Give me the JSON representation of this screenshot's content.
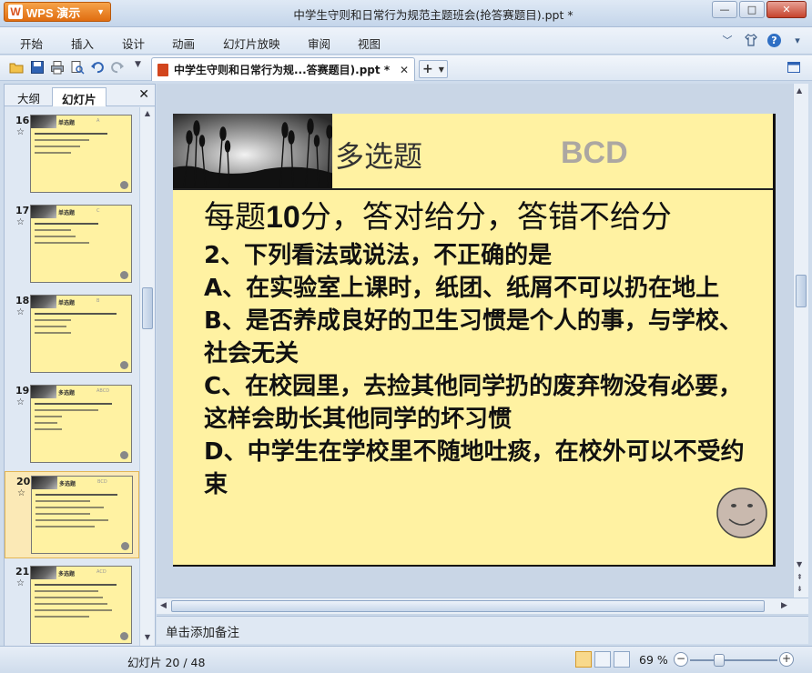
{
  "window": {
    "app_name": "WPS 演示",
    "title": "中学生守则和日常行为规范主题班会(抢答赛题目).ppt *",
    "min": "—",
    "max": "□",
    "close": "✕"
  },
  "menu": {
    "items": [
      "开始",
      "插入",
      "设计",
      "动画",
      "幻灯片放映",
      "审阅",
      "视图"
    ]
  },
  "tabstrip": {
    "doc_tab": "中学生守则和日常行为规...答赛题目).ppt *",
    "close": "✕",
    "add": "+"
  },
  "leftpanel": {
    "tabs": [
      "大纲",
      "幻灯片"
    ],
    "close": "✕",
    "thumbnails": [
      {
        "num": "16",
        "title": "单选题",
        "answer": "A",
        "star": "☆"
      },
      {
        "num": "17",
        "title": "单选题",
        "answer": "C",
        "star": "☆"
      },
      {
        "num": "18",
        "title": "单选题",
        "answer": "B",
        "star": "☆"
      },
      {
        "num": "19",
        "title": "多选题",
        "answer": "ABCD",
        "star": "☆"
      },
      {
        "num": "20",
        "title": "多选题",
        "answer": "BCD",
        "star": "☆"
      },
      {
        "num": "21",
        "title": "多选题",
        "answer": "ACD",
        "star": "☆"
      }
    ],
    "selected": "20"
  },
  "slide": {
    "title": "多选题",
    "answer": "BCD",
    "subtitle_pre": "每题",
    "subtitle_num": "10",
    "subtitle_post": "分，答对给分，答错不给分",
    "question": "2、下列看法或说法，不正确的是",
    "option_a": "A、在实验室上课时，纸团、纸屑不可以扔在地上",
    "option_b": "B、是否养成良好的卫生习惯是个人的事，与学校、社会无关",
    "option_c": "C、在校园里，去捡其他同学扔的废弃物没有必要，这样会助长其他同学的坏习惯",
    "option_d": "D、中学生在学校里不随地吐痰，在校外可以不受约束"
  },
  "notes": {
    "placeholder": "单击添加备注"
  },
  "status": {
    "slide_counter": "幻灯片 20 / 48",
    "zoom": "69 %",
    "zoom_minus": "−",
    "zoom_plus": "+"
  },
  "colors": {
    "slide_bg": "#fff2a2",
    "accent_orange": "#e06d10",
    "answer_gray": "#aca7a2"
  }
}
